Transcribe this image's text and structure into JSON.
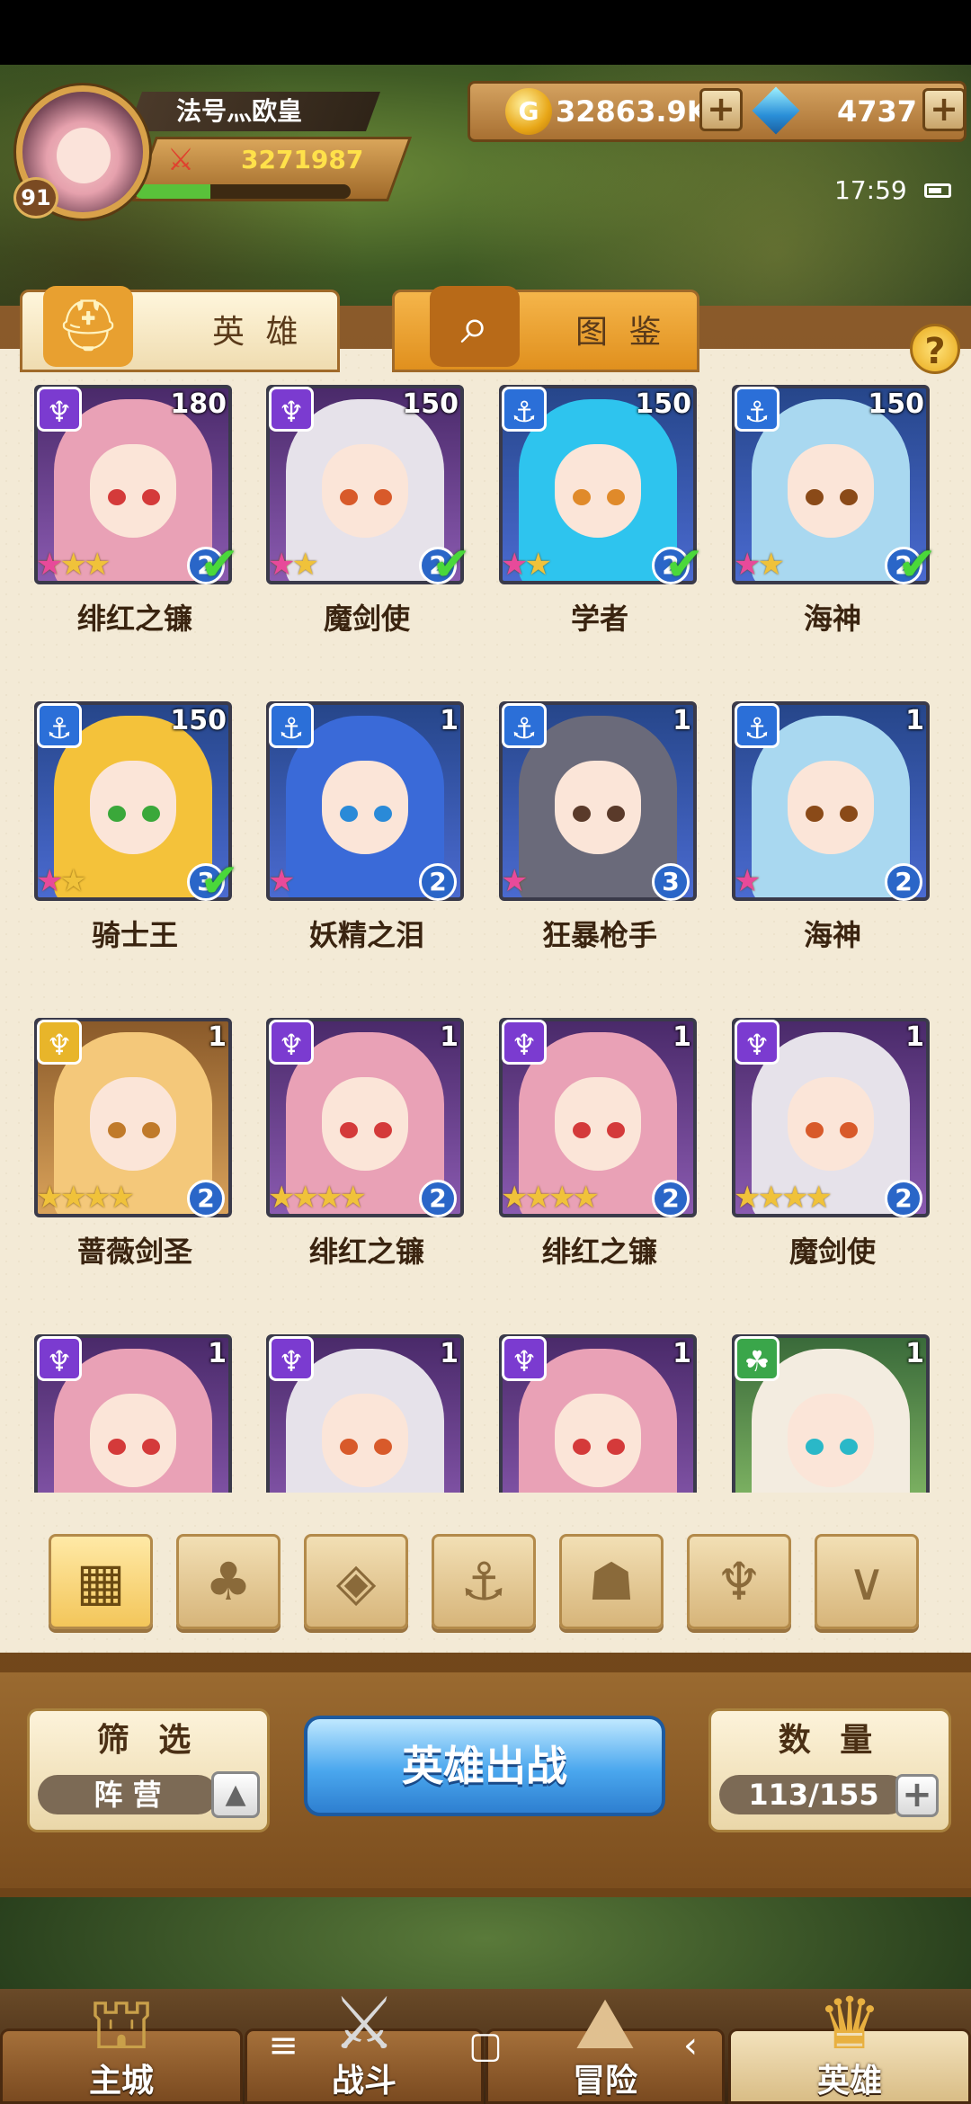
{
  "player": {
    "name": "法号灬欧皇",
    "level": "91",
    "power": "3271987",
    "xp_fraction": 0.35
  },
  "resources": {
    "gold": "32863.9K",
    "gems": "4737"
  },
  "status": {
    "time": "17:59"
  },
  "tabs": [
    {
      "label": "英 雄"
    },
    {
      "label": "图 鉴"
    }
  ],
  "help_label": "?",
  "heroes": [
    {
      "name": "绯红之镰",
      "level": "180",
      "grade": "2",
      "stars": "★★★",
      "camp": "dark",
      "camp_icon": "♆",
      "hair": "#e9a1b6",
      "eye": "#d43a3a",
      "owned_check": true
    },
    {
      "name": "魔剑使",
      "level": "150",
      "grade": "2",
      "stars": "★★",
      "camp": "dark",
      "camp_icon": "♆",
      "hair": "#e6e2ea",
      "eye": "#d85a2a",
      "owned_check": true
    },
    {
      "name": "学者",
      "level": "150",
      "grade": "2",
      "stars": "★★",
      "camp": "sea",
      "camp_icon": "⚓",
      "hair": "#2ec4ee",
      "eye": "#e08a2a",
      "owned_check": true
    },
    {
      "name": "海神",
      "level": "150",
      "grade": "2",
      "stars": "★★",
      "camp": "sea",
      "camp_icon": "⚓",
      "hair": "#a9d8f0",
      "eye": "#8a4a18",
      "owned_check": true
    },
    {
      "name": "骑士王",
      "level": "150",
      "grade": "3",
      "stars": "★★",
      "camp": "sea",
      "camp_icon": "⚓",
      "hair": "#f4c23a",
      "eye": "#3aa83a",
      "owned_check": true
    },
    {
      "name": "妖精之泪",
      "level": "1",
      "grade": "2",
      "stars": "★",
      "camp": "sea",
      "camp_icon": "⚓",
      "hair": "#3a6ad8",
      "eye": "#2a8ad8",
      "owned_check": false
    },
    {
      "name": "狂暴枪手",
      "level": "1",
      "grade": "3",
      "stars": "★",
      "camp": "sea",
      "camp_icon": "⚓",
      "hair": "#6a6a7a",
      "eye": "#5a3a2a",
      "owned_check": false
    },
    {
      "name": "海神",
      "level": "1",
      "grade": "2",
      "stars": "★",
      "camp": "sea",
      "camp_icon": "⚓",
      "hair": "#a9d8f0",
      "eye": "#8a4a18",
      "owned_check": false
    },
    {
      "name": "蔷薇剑圣",
      "level": "1",
      "grade": "2",
      "stars": "★★★★",
      "camp": "light",
      "camp_icon": "♆",
      "hair": "#f4c87a",
      "eye": "#c07a2a",
      "owned_check": false
    },
    {
      "name": "绯红之镰",
      "level": "1",
      "grade": "2",
      "stars": "★★★★",
      "camp": "dark",
      "camp_icon": "♆",
      "hair": "#e9a1b6",
      "eye": "#d43a3a",
      "owned_check": false
    },
    {
      "name": "绯红之镰",
      "level": "1",
      "grade": "2",
      "stars": "★★★★",
      "camp": "dark",
      "camp_icon": "♆",
      "hair": "#e9a1b6",
      "eye": "#d43a3a",
      "owned_check": false
    },
    {
      "name": "魔剑使",
      "level": "1",
      "grade": "2",
      "stars": "★★★★",
      "camp": "dark",
      "camp_icon": "♆",
      "hair": "#e6e2ea",
      "eye": "#d85a2a",
      "owned_check": false
    },
    {
      "name": "",
      "level": "1",
      "grade": "",
      "stars": "",
      "camp": "dark",
      "camp_icon": "♆",
      "hair": "#e9a1b6",
      "eye": "#d43a3a",
      "owned_check": false
    },
    {
      "name": "",
      "level": "1",
      "grade": "",
      "stars": "",
      "camp": "dark",
      "camp_icon": "♆",
      "hair": "#e6e2ea",
      "eye": "#d85a2a",
      "owned_check": false
    },
    {
      "name": "",
      "level": "1",
      "grade": "",
      "stars": "",
      "camp": "dark",
      "camp_icon": "♆",
      "hair": "#e9a1b6",
      "eye": "#d43a3a",
      "owned_check": false
    },
    {
      "name": "",
      "level": "1",
      "grade": "",
      "stars": "",
      "camp": "forest",
      "camp_icon": "☘",
      "hair": "#f3ece0",
      "eye": "#2ab8c8",
      "owned_check": false
    }
  ],
  "camp_filters": [
    {
      "name": "all",
      "icon": "▦"
    },
    {
      "name": "forest",
      "icon": "♣"
    },
    {
      "name": "light",
      "icon": "◈"
    },
    {
      "name": "sea",
      "icon": "⚓"
    },
    {
      "name": "beast",
      "icon": "☗"
    },
    {
      "name": "dark",
      "icon": "♆"
    },
    {
      "name": "void",
      "icon": "∨"
    }
  ],
  "filter_panel": {
    "title": "筛 选",
    "value": "阵 营",
    "arrow": "▲"
  },
  "deploy_button": "英雄出战",
  "capacity": {
    "title": "数 量",
    "value": "113/155"
  },
  "nav": [
    {
      "label": "主城",
      "icon": "⛫"
    },
    {
      "label": "战斗",
      "icon": "⚔"
    },
    {
      "label": "冒险",
      "icon": "⛰"
    },
    {
      "label": "英雄",
      "icon": "♛"
    }
  ],
  "system_nav": {
    "menu": "≡",
    "home": "▢",
    "back": "‹"
  },
  "colors": {
    "camp_dark": "#7b3bd0",
    "camp_sea": "#2b6fd8",
    "camp_light": "#e8b52a",
    "camp_forest": "#3aa64a",
    "check_green": "#4ad83a",
    "deploy_blue": "#4aa7ee"
  }
}
